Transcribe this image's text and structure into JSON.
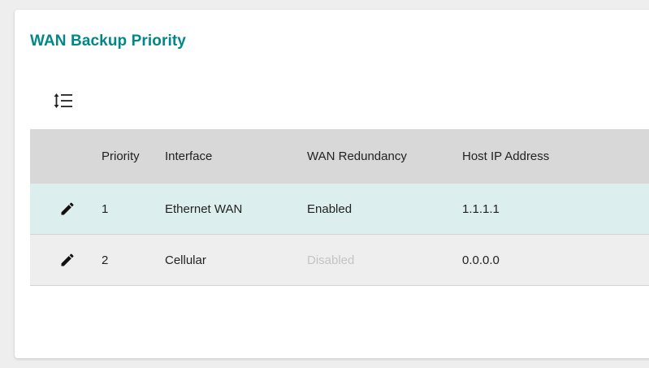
{
  "panel": {
    "title": "WAN Backup Priority"
  },
  "toolbar": {
    "reorder_icon": "sort-reorder-icon"
  },
  "table": {
    "columns": [
      "",
      "Priority",
      "Interface",
      "WAN Redundancy",
      "Host IP Address"
    ],
    "rows": [
      {
        "priority": "1",
        "interface": "Ethernet WAN",
        "wan_redundancy": "Enabled",
        "host_ip": "1.1.1.1",
        "highlighted": true
      },
      {
        "priority": "2",
        "interface": "Cellular",
        "wan_redundancy": "Disabled",
        "host_ip": "0.0.0.0",
        "highlighted": false
      }
    ],
    "edit_icon": "pencil-edit-icon"
  },
  "colors": {
    "title": "#008787",
    "header_bg": "#d8d8d8",
    "selected_row_bg": "#dcefee",
    "row_bg": "#eeeeee",
    "disabled_text": "#c4c4c4"
  }
}
